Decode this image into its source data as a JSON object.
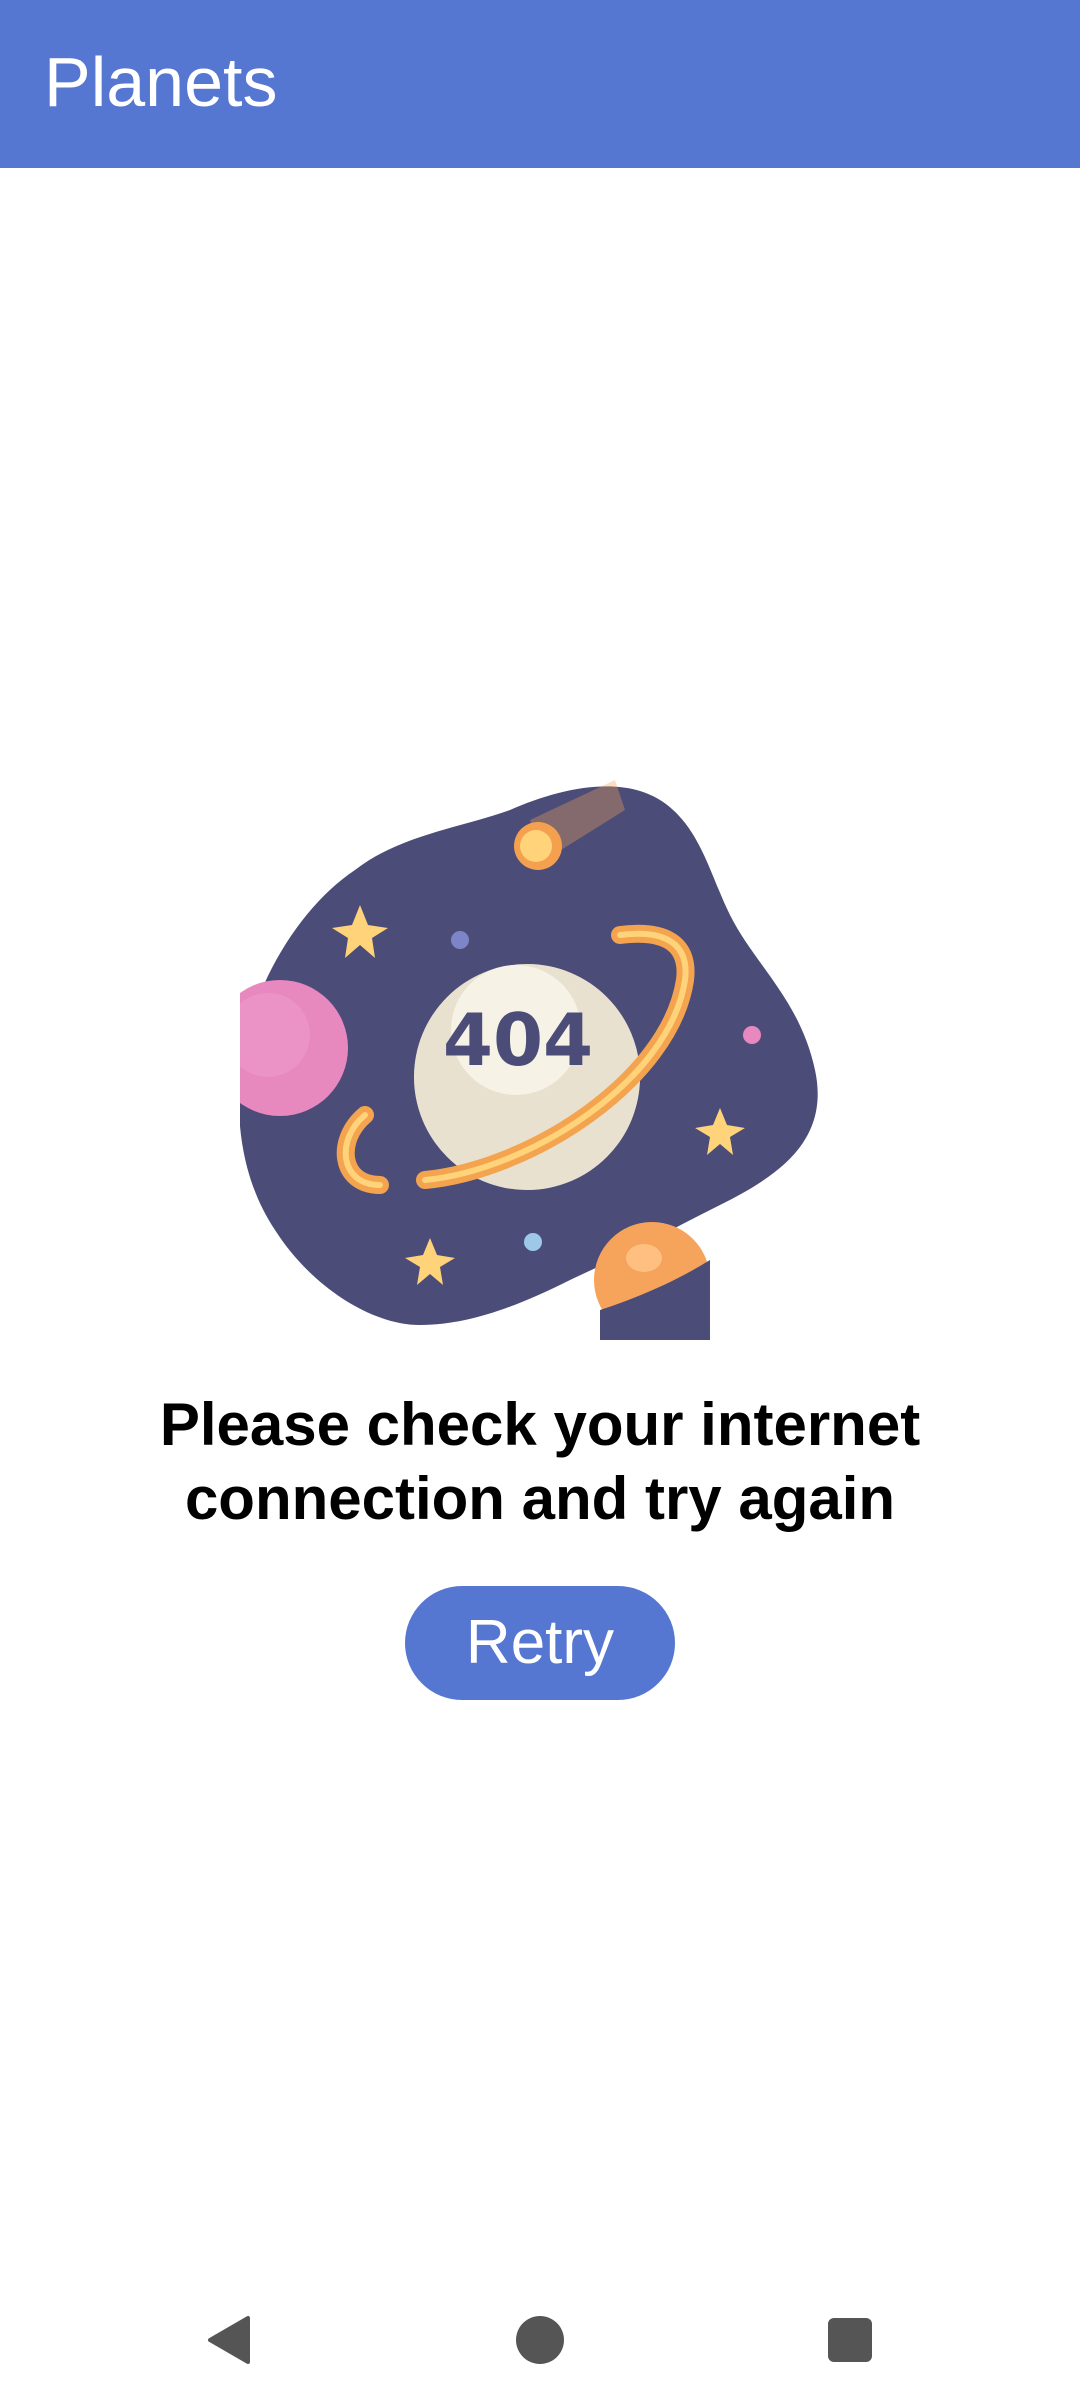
{
  "app_bar": {
    "title": "Planets",
    "color": "#5677d1"
  },
  "error": {
    "illustration_code": "404",
    "message_line1": "Please check your internet",
    "message_line2": "connection and try again"
  },
  "actions": {
    "retry_label": "Retry"
  },
  "nav": {
    "back_icon": "back-triangle-icon",
    "home_icon": "home-circle-icon",
    "recents_icon": "recents-square-icon"
  }
}
